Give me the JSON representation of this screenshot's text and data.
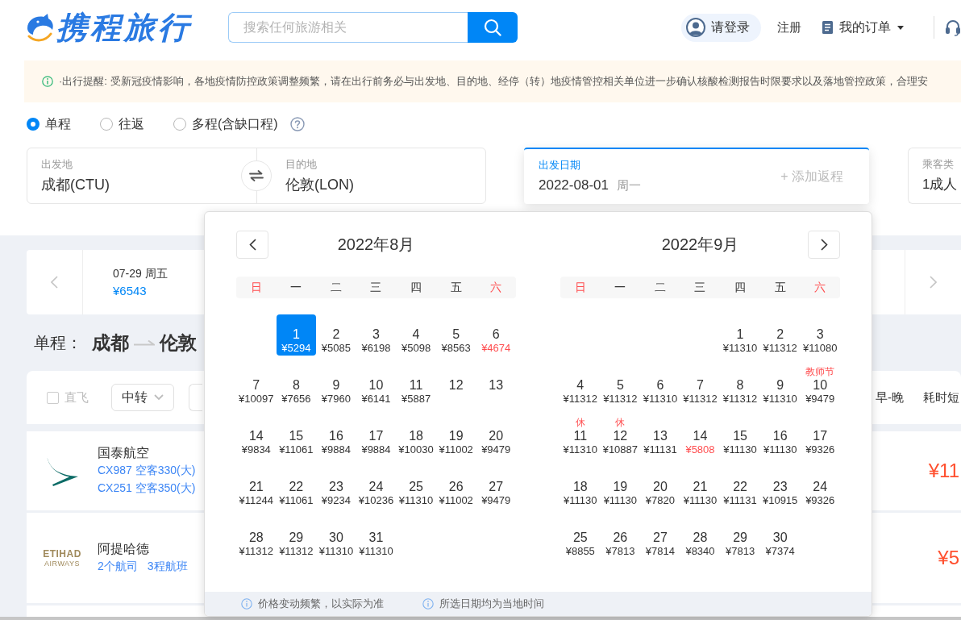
{
  "header": {
    "logo_text": "携程旅行",
    "search": {
      "placeholder": "搜索任何旅游相关"
    },
    "login": "请登录",
    "register": "注册",
    "orders": "我的订单"
  },
  "notice": {
    "text": "·出行提醒: 受新冠疫情影响，各地疫情防控政策调整频繁，请在出行前务必与出发地、目的地、经停（转）地疫情管控相关单位进一步确认核酸检测报告时限要求以及落地管控政策，合理安"
  },
  "trip_types": [
    {
      "label": "单程",
      "selected": true
    },
    {
      "label": "往返",
      "selected": false
    },
    {
      "label": "多程(含缺口程)",
      "selected": false
    }
  ],
  "search_form": {
    "departure": {
      "label": "出发地",
      "value": "成都(CTU)"
    },
    "destination": {
      "label": "目的地",
      "value": "伦敦(LON)"
    },
    "date": {
      "label": "出发日期",
      "value": "2022-08-01",
      "weekday": "周一"
    },
    "add_return": "+ 添加返程",
    "passengers": {
      "label": "乘客类",
      "value": "1成人"
    }
  },
  "date_strip": {
    "items": [
      {
        "date": "07-29 周五",
        "price": "¥6543"
      }
    ]
  },
  "route": {
    "trip_type": "单程：",
    "from": "成都",
    "to": "伦敦"
  },
  "filters": {
    "direct": {
      "label": "直飞",
      "checked": false,
      "disabled": true
    },
    "transfer": {
      "label": "中转"
    },
    "sorts": [
      "早-晚",
      "耗时短"
    ]
  },
  "flights": [
    {
      "airline": "国泰航空",
      "logo": {
        "kind": "swoosh"
      },
      "segments": [
        "CX987 空客330(大)",
        "CX251 空客350(大)"
      ],
      "price": "¥11"
    },
    {
      "airline": "阿提哈德",
      "logo": {
        "kind": "wordmark",
        "text": "ETIHAD",
        "subtext": "AIRWAYS"
      },
      "summary": [
        "2个航司",
        "3程航班"
      ],
      "price": "¥5"
    }
  ],
  "calendar": {
    "months": [
      {
        "title": "2022年8月",
        "weekdays": [
          {
            "label": "日",
            "weekend": true
          },
          {
            "label": "一",
            "weekend": false
          },
          {
            "label": "二",
            "weekend": false
          },
          {
            "label": "三",
            "weekend": false
          },
          {
            "label": "四",
            "weekend": false
          },
          {
            "label": "五",
            "weekend": false
          },
          {
            "label": "六",
            "weekend": true
          }
        ],
        "weeks": [
          [
            {
              "kind": "blank"
            },
            {
              "kind": "day",
              "date": "1",
              "price": "¥5294",
              "selected": true,
              "lowest": false
            },
            {
              "kind": "day",
              "date": "2",
              "price": "¥5085",
              "selected": false,
              "lowest": false
            },
            {
              "kind": "day",
              "date": "3",
              "price": "¥6198",
              "selected": false,
              "lowest": false
            },
            {
              "kind": "day",
              "date": "4",
              "price": "¥5098",
              "selected": false,
              "lowest": false
            },
            {
              "kind": "day",
              "date": "5",
              "price": "¥8563",
              "selected": false,
              "lowest": false
            },
            {
              "kind": "day",
              "date": "6",
              "price": "¥4674",
              "selected": false,
              "lowest": true
            }
          ],
          [
            {
              "kind": "day",
              "date": "7",
              "price": "¥10097",
              "selected": false,
              "lowest": false
            },
            {
              "kind": "day",
              "date": "8",
              "price": "¥7656",
              "selected": false,
              "lowest": false
            },
            {
              "kind": "day",
              "date": "9",
              "price": "¥7960",
              "selected": false,
              "lowest": false
            },
            {
              "kind": "day",
              "date": "10",
              "price": "¥6141",
              "selected": false,
              "lowest": false
            },
            {
              "kind": "day",
              "date": "11",
              "price": "¥5887",
              "selected": false,
              "lowest": false
            },
            {
              "kind": "day",
              "date": "12",
              "selected": false
            },
            {
              "kind": "day",
              "date": "13",
              "selected": false
            }
          ],
          [
            {
              "kind": "day",
              "date": "14",
              "price": "¥9834",
              "selected": false,
              "lowest": false
            },
            {
              "kind": "day",
              "date": "15",
              "price": "¥11061",
              "selected": false,
              "lowest": false
            },
            {
              "kind": "day",
              "date": "16",
              "price": "¥9884",
              "selected": false,
              "lowest": false
            },
            {
              "kind": "day",
              "date": "17",
              "price": "¥9884",
              "selected": false,
              "lowest": false
            },
            {
              "kind": "day",
              "date": "18",
              "price": "¥10030",
              "selected": false,
              "lowest": false
            },
            {
              "kind": "day",
              "date": "19",
              "price": "¥11002",
              "selected": false,
              "lowest": false
            },
            {
              "kind": "day",
              "date": "20",
              "price": "¥9479",
              "selected": false,
              "lowest": false
            }
          ],
          [
            {
              "kind": "day",
              "date": "21",
              "price": "¥11244",
              "selected": false,
              "lowest": false
            },
            {
              "kind": "day",
              "date": "22",
              "price": "¥11061",
              "selected": false,
              "lowest": false
            },
            {
              "kind": "day",
              "date": "23",
              "price": "¥9234",
              "selected": false,
              "lowest": false
            },
            {
              "kind": "day",
              "date": "24",
              "price": "¥10236",
              "selected": false,
              "lowest": false
            },
            {
              "kind": "day",
              "date": "25",
              "price": "¥11310",
              "selected": false,
              "lowest": false
            },
            {
              "kind": "day",
              "date": "26",
              "price": "¥11002",
              "selected": false,
              "lowest": false
            },
            {
              "kind": "day",
              "date": "27",
              "price": "¥9479",
              "selected": false,
              "lowest": false
            }
          ],
          [
            {
              "kind": "day",
              "date": "28",
              "price": "¥11312",
              "selected": false,
              "lowest": false
            },
            {
              "kind": "day",
              "date": "29",
              "price": "¥11312",
              "selected": false,
              "lowest": false
            },
            {
              "kind": "day",
              "date": "30",
              "price": "¥11310",
              "selected": false,
              "lowest": false
            },
            {
              "kind": "day",
              "date": "31",
              "price": "¥11310",
              "selected": false,
              "lowest": false
            }
          ]
        ]
      },
      {
        "title": "2022年9月",
        "weekdays": [
          {
            "label": "日",
            "weekend": true
          },
          {
            "label": "一",
            "weekend": false
          },
          {
            "label": "二",
            "weekend": false
          },
          {
            "label": "三",
            "weekend": false
          },
          {
            "label": "四",
            "weekend": false
          },
          {
            "label": "五",
            "weekend": false
          },
          {
            "label": "六",
            "weekend": true
          }
        ],
        "weeks": [
          [
            {
              "kind": "blank"
            },
            {
              "kind": "blank"
            },
            {
              "kind": "blank"
            },
            {
              "kind": "blank"
            },
            {
              "kind": "day",
              "date": "1",
              "price": "¥11310",
              "selected": false,
              "lowest": false
            },
            {
              "kind": "day",
              "date": "2",
              "price": "¥11312",
              "selected": false,
              "lowest": false
            },
            {
              "kind": "day",
              "date": "3",
              "price": "¥11080",
              "selected": false,
              "lowest": false
            }
          ],
          [
            {
              "kind": "day",
              "date": "4",
              "price": "¥11312",
              "selected": false,
              "lowest": false
            },
            {
              "kind": "day",
              "date": "5",
              "price": "¥11312",
              "selected": false,
              "lowest": false
            },
            {
              "kind": "day",
              "date": "6",
              "price": "¥11310",
              "selected": false,
              "lowest": false
            },
            {
              "kind": "day",
              "date": "7",
              "price": "¥11312",
              "selected": false,
              "lowest": false
            },
            {
              "kind": "day",
              "date": "8",
              "price": "¥11312",
              "selected": false,
              "lowest": false
            },
            {
              "kind": "day",
              "date": "9",
              "price": "¥11310",
              "selected": false,
              "lowest": false
            },
            {
              "kind": "day",
              "date": "10",
              "price": "¥9479",
              "selected": false,
              "lowest": false,
              "note": "教师节"
            }
          ],
          [
            {
              "kind": "day",
              "date": "11",
              "price": "¥11310",
              "selected": false,
              "lowest": false,
              "note": "休"
            },
            {
              "kind": "day",
              "date": "12",
              "price": "¥10887",
              "selected": false,
              "lowest": false,
              "note": "休"
            },
            {
              "kind": "day",
              "date": "13",
              "price": "¥11131",
              "selected": false,
              "lowest": false
            },
            {
              "kind": "day",
              "date": "14",
              "price": "¥5808",
              "selected": false,
              "lowest": true
            },
            {
              "kind": "day",
              "date": "15",
              "price": "¥11130",
              "selected": false,
              "lowest": false
            },
            {
              "kind": "day",
              "date": "16",
              "price": "¥11130",
              "selected": false,
              "lowest": false
            },
            {
              "kind": "day",
              "date": "17",
              "price": "¥9326",
              "selected": false,
              "lowest": false
            }
          ],
          [
            {
              "kind": "day",
              "date": "18",
              "price": "¥11130",
              "selected": false,
              "lowest": false
            },
            {
              "kind": "day",
              "date": "19",
              "price": "¥11130",
              "selected": false,
              "lowest": false
            },
            {
              "kind": "day",
              "date": "20",
              "price": "¥7820",
              "selected": false,
              "lowest": false
            },
            {
              "kind": "day",
              "date": "21",
              "price": "¥11130",
              "selected": false,
              "lowest": false
            },
            {
              "kind": "day",
              "date": "22",
              "price": "¥11131",
              "selected": false,
              "lowest": false
            },
            {
              "kind": "day",
              "date": "23",
              "price": "¥10915",
              "selected": false,
              "lowest": false
            },
            {
              "kind": "day",
              "date": "24",
              "price": "¥9326",
              "selected": false,
              "lowest": false
            }
          ],
          [
            {
              "kind": "day",
              "date": "25",
              "price": "¥8855",
              "selected": false,
              "lowest": false
            },
            {
              "kind": "day",
              "date": "26",
              "price": "¥7813",
              "selected": false,
              "lowest": false
            },
            {
              "kind": "day",
              "date": "27",
              "price": "¥7814",
              "selected": false,
              "lowest": false
            },
            {
              "kind": "day",
              "date": "28",
              "price": "¥8340",
              "selected": false,
              "lowest": false
            },
            {
              "kind": "day",
              "date": "29",
              "price": "¥7813",
              "selected": false,
              "lowest": false
            },
            {
              "kind": "day",
              "date": "30",
              "price": "¥7374",
              "selected": false,
              "lowest": false
            }
          ]
        ]
      }
    ],
    "notes": [
      "价格变动频繁，以实际为准",
      "所选日期均为当地时间"
    ]
  }
}
